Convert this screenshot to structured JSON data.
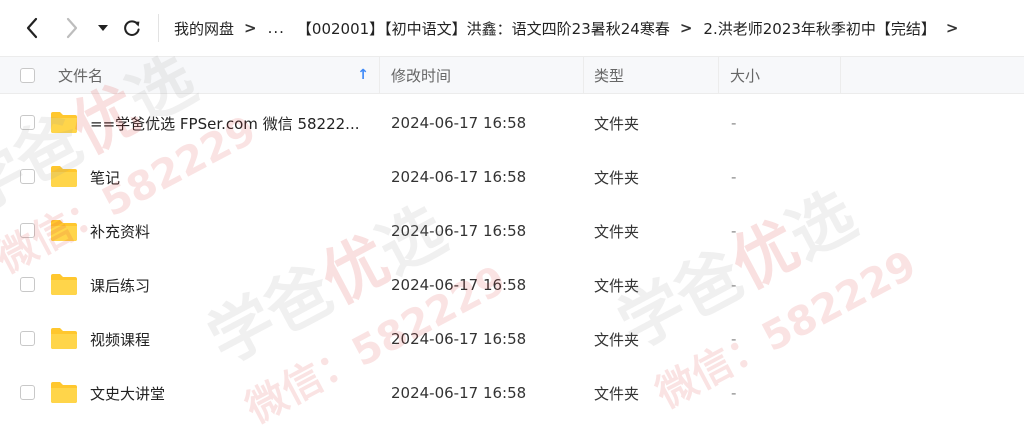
{
  "nav": {
    "back_icon": "chevron-left-icon",
    "forward_icon": "chevron-right-icon",
    "dropdown_icon": "caret-down-icon",
    "refresh_icon": "refresh-icon"
  },
  "breadcrumb": {
    "items": [
      "我的网盘",
      "...",
      "【002001】【初中语文】洪鑫：语文四阶23暑秋24寒春",
      "2.洪老师2023年秋季初中【完结】"
    ],
    "separator": ">"
  },
  "columns": {
    "name": "文件名",
    "modified": "修改时间",
    "type": "类型",
    "size": "大小"
  },
  "files": [
    {
      "name": "==学爸优选 FPSer.com 微信 58222...",
      "modified": "2024-06-17 16:58",
      "type": "文件夹",
      "size": "-"
    },
    {
      "name": "笔记",
      "modified": "2024-06-17 16:58",
      "type": "文件夹",
      "size": "-"
    },
    {
      "name": "补充资料",
      "modified": "2024-06-17 16:58",
      "type": "文件夹",
      "size": "-"
    },
    {
      "name": "课后练习",
      "modified": "2024-06-17 16:58",
      "type": "文件夹",
      "size": "-"
    },
    {
      "name": "视频课程",
      "modified": "2024-06-17 16:58",
      "type": "文件夹",
      "size": "-"
    },
    {
      "name": "文史大讲堂",
      "modified": "2024-06-17 16:58",
      "type": "文件夹",
      "size": "-"
    }
  ],
  "watermark": {
    "line1_a": "学爸",
    "line1_b": "优",
    "line1_c": "选",
    "line2": "微信：582229"
  },
  "colors": {
    "accent": "#3f8af7",
    "folder": "#ffc72e",
    "header_bg": "#f7f8fa"
  }
}
